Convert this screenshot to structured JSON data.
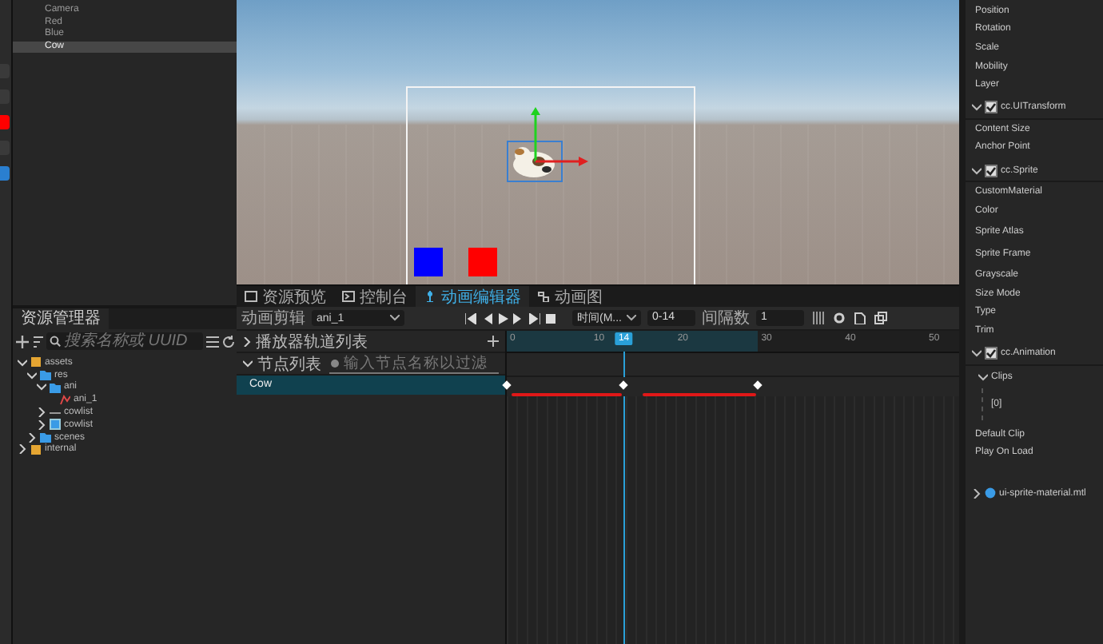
{
  "hierarchy": {
    "items": [
      {
        "label": "Camera",
        "selected": false
      },
      {
        "label": "Red",
        "selected": false
      },
      {
        "label": "Blue",
        "selected": false
      },
      {
        "label": "Cow",
        "selected": true
      }
    ]
  },
  "assets": {
    "tab": "资源管理器",
    "search": {
      "placeholder": "搜索名称或 UUID"
    },
    "tree": [
      {
        "label": "assets",
        "kind": "db",
        "expanded": true,
        "children": [
          {
            "label": "res",
            "kind": "folder",
            "expanded": true,
            "children": [
              {
                "label": "ani",
                "kind": "folder",
                "expanded": true,
                "children": [
                  {
                    "label": "ani_1",
                    "kind": "anim"
                  }
                ]
              },
              {
                "label": "cowlist",
                "kind": "plist",
                "expanded": false
              },
              {
                "label": "cowlist",
                "kind": "image",
                "expanded": false
              }
            ]
          },
          {
            "label": "scenes",
            "kind": "folder",
            "expanded": false
          }
        ]
      },
      {
        "label": "internal",
        "kind": "db",
        "expanded": false
      }
    ]
  },
  "bottom_tabs": [
    {
      "label": "资源预览",
      "kind": "preview",
      "selected": false
    },
    {
      "label": "控制台",
      "kind": "console",
      "selected": false
    },
    {
      "label": "动画编辑器",
      "kind": "animation",
      "selected": true
    },
    {
      "label": "动画图",
      "kind": "graph",
      "selected": false
    }
  ],
  "animation_editor": {
    "clip_label": "动画剪辑",
    "clip": "ani_1",
    "time_mode": "时间(M...",
    "range": "0-14",
    "interval_label": "间隔数",
    "interval": "1",
    "tracks_label": "播放器轨道列表",
    "nodes_label": "节点列表",
    "node_search": {
      "placeholder": "输入节点名称以过滤"
    },
    "ruler": [
      "0",
      "10",
      "20",
      "30",
      "40",
      "50"
    ],
    "cursor": {
      "label": "14",
      "level": 0.259
    },
    "nodes": [
      {
        "label": "Cow",
        "selected": true
      }
    ],
    "keyframes": [
      {
        "level": 0
      },
      {
        "level": 0.259
      },
      {
        "level": 0.556
      }
    ]
  },
  "inspector": {
    "rows": [
      {
        "kind": "prop",
        "label": "Position"
      },
      {
        "kind": "prop",
        "label": "Rotation"
      },
      {
        "kind": "prop",
        "label": "Scale"
      },
      {
        "kind": "prop",
        "label": "Mobility"
      },
      {
        "kind": "prop",
        "label": "Layer"
      },
      {
        "kind": "component",
        "label": "cc.UITransform",
        "expanded": true,
        "checked": true
      },
      {
        "kind": "prop",
        "label": "Content Size"
      },
      {
        "kind": "prop",
        "label": "Anchor Point"
      },
      {
        "kind": "component",
        "label": "cc.Sprite",
        "expanded": true,
        "checked": true
      },
      {
        "kind": "prop",
        "label": "CustomMaterial"
      },
      {
        "kind": "prop",
        "label": "Color"
      },
      {
        "kind": "tall",
        "label": "Sprite Atlas"
      },
      {
        "kind": "tall",
        "label": "Sprite Frame"
      },
      {
        "kind": "prop",
        "label": "Grayscale"
      },
      {
        "kind": "prop",
        "label": "Size Mode"
      },
      {
        "kind": "prop",
        "label": "Type"
      },
      {
        "kind": "prop",
        "label": "Trim"
      },
      {
        "kind": "component",
        "label": "cc.Animation",
        "expanded": true,
        "checked": true
      },
      {
        "kind": "group",
        "label": "Clips",
        "expanded": true
      },
      {
        "kind": "element",
        "label": "[0]"
      },
      {
        "kind": "prop",
        "label": "Default Clip"
      },
      {
        "kind": "prop",
        "label": "Play On Load"
      },
      {
        "kind": "asset",
        "label": "ui-sprite-material.mtl",
        "expanded": false
      }
    ]
  }
}
